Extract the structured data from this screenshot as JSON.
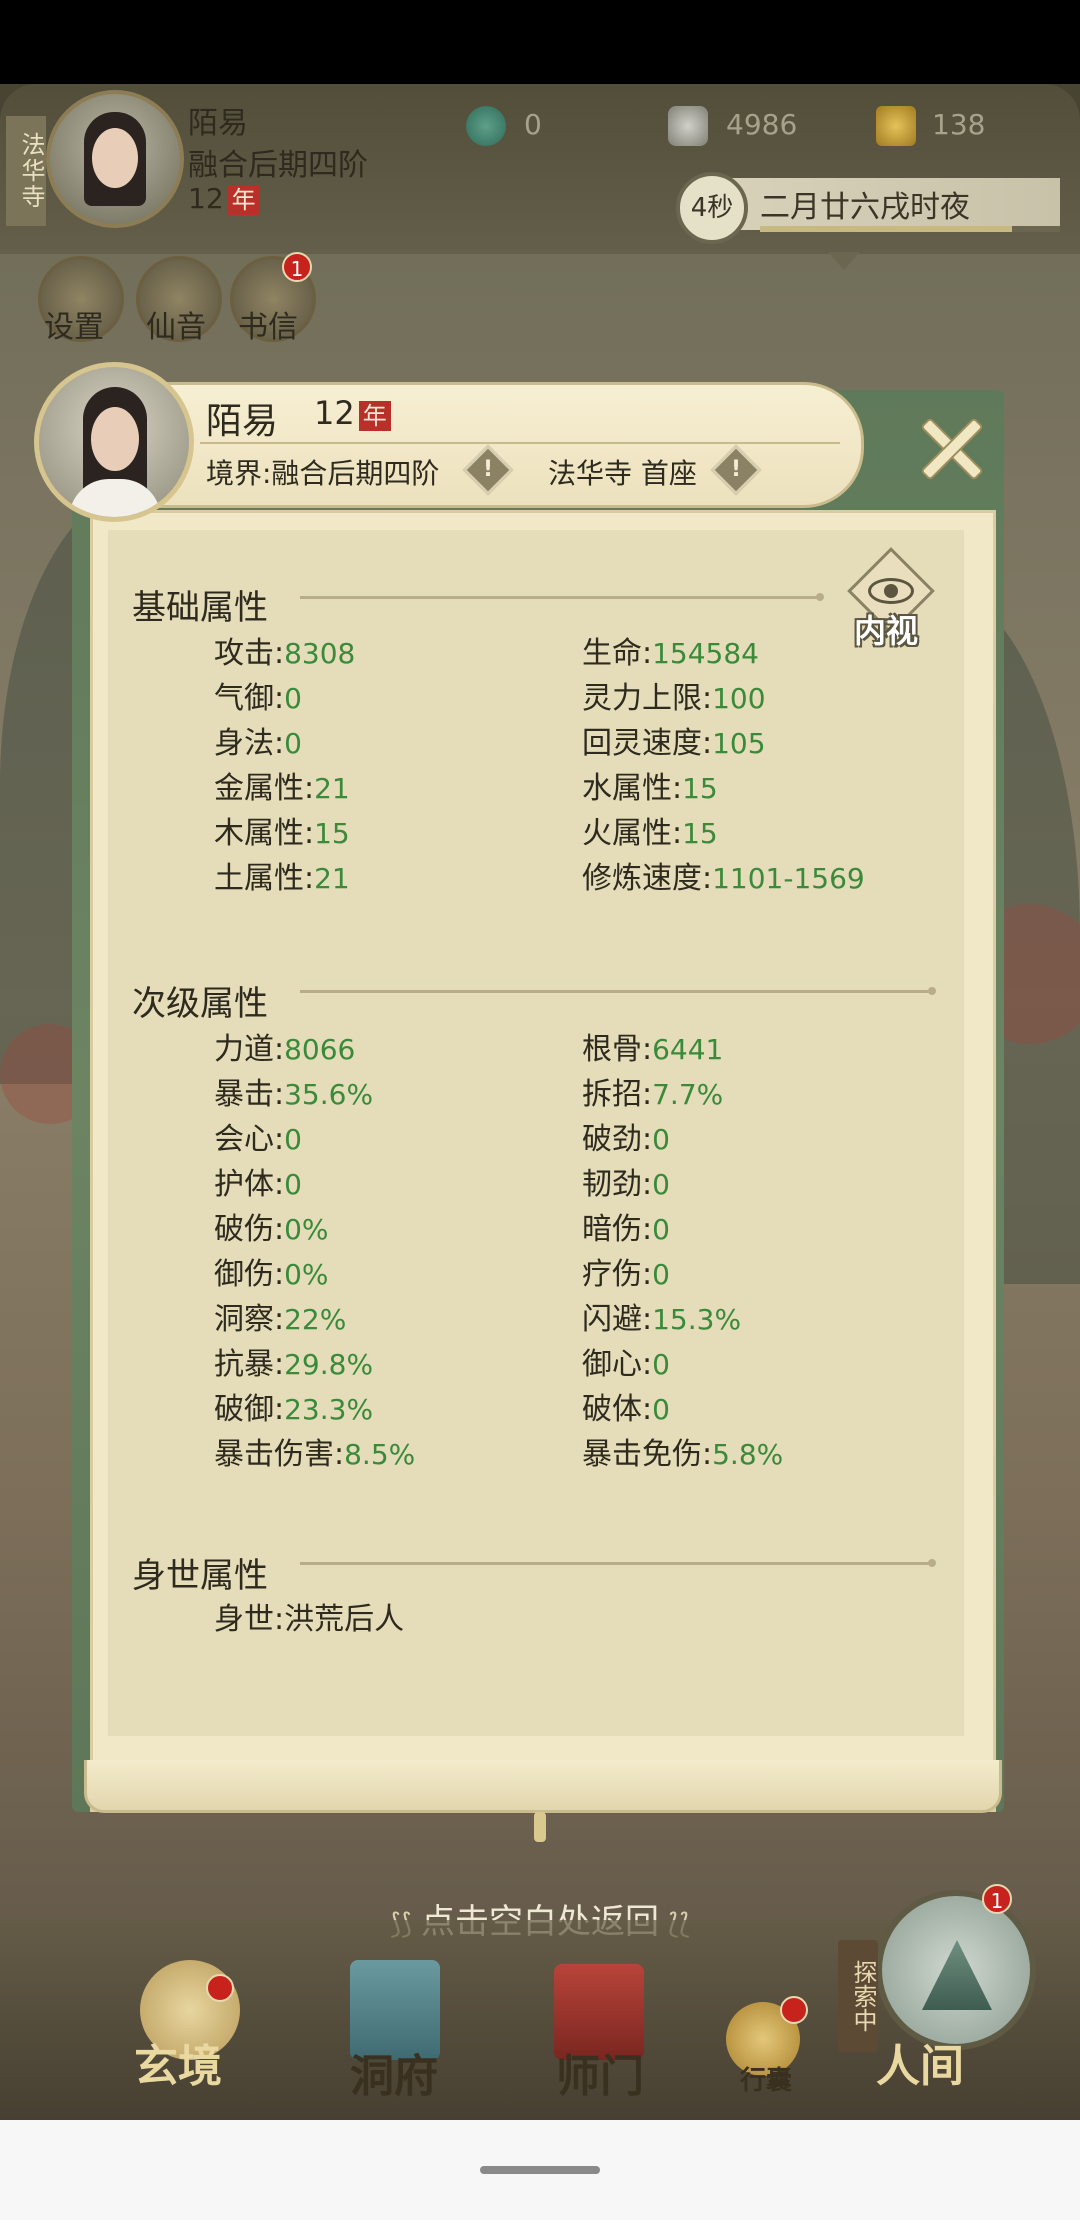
{
  "hud": {
    "sect_tag": "法华寺",
    "player_name": "陌易",
    "realm": "融合后期四阶",
    "age": "12",
    "age_unit": "年",
    "resources": [
      {
        "icon": "jade-icon",
        "value": "0"
      },
      {
        "icon": "coin-icon",
        "value": "4986"
      },
      {
        "icon": "gold-ingot-icon",
        "value": "138"
      }
    ],
    "timer": "4秒",
    "time_text": "二月廿六戌时夜",
    "menu": [
      {
        "label": "设置",
        "icon": "settings-icon"
      },
      {
        "label": "仙音",
        "icon": "music-icon"
      },
      {
        "label": "书信",
        "icon": "letter-icon",
        "badge": "1"
      }
    ]
  },
  "modal": {
    "name": "陌易",
    "age": "12",
    "age_unit": "年",
    "realm_label": "境界:融合后期四阶",
    "sect_label": "法华寺 首座",
    "inner_view_label": "内视",
    "sections": {
      "basic": {
        "title": "基础属性",
        "stats": [
          {
            "name": "攻击",
            "value": "8308"
          },
          {
            "name": "生命",
            "value": "154584"
          },
          {
            "name": "气御",
            "value": "0"
          },
          {
            "name": "灵力上限",
            "value": "100"
          },
          {
            "name": "身法",
            "value": "0"
          },
          {
            "name": "回灵速度",
            "value": "105"
          },
          {
            "name": "金属性",
            "value": "21"
          },
          {
            "name": "水属性",
            "value": "15"
          },
          {
            "name": "木属性",
            "value": "15"
          },
          {
            "name": "火属性",
            "value": "15"
          },
          {
            "name": "土属性",
            "value": "21"
          },
          {
            "name": "修炼速度",
            "value": "1101-1569"
          }
        ]
      },
      "secondary": {
        "title": "次级属性",
        "stats": [
          {
            "name": "力道",
            "value": "8066"
          },
          {
            "name": "根骨",
            "value": "6441"
          },
          {
            "name": "暴击",
            "value": "35.6%"
          },
          {
            "name": "拆招",
            "value": "7.7%"
          },
          {
            "name": "会心",
            "value": "0"
          },
          {
            "name": "破劲",
            "value": "0"
          },
          {
            "name": "护体",
            "value": "0"
          },
          {
            "name": "韧劲",
            "value": "0"
          },
          {
            "name": "破伤",
            "value": "0%"
          },
          {
            "name": "暗伤",
            "value": "0"
          },
          {
            "name": "御伤",
            "value": "0%"
          },
          {
            "name": "疗伤",
            "value": "0"
          },
          {
            "name": "洞察",
            "value": "22%"
          },
          {
            "name": "闪避",
            "value": "15.3%"
          },
          {
            "name": "抗暴",
            "value": "29.8%"
          },
          {
            "name": "御心",
            "value": "0"
          },
          {
            "name": "破御",
            "value": "23.3%"
          },
          {
            "name": "破体",
            "value": "0"
          },
          {
            "name": "暴击伤害",
            "value": "8.5%"
          },
          {
            "name": "暴击免伤",
            "value": "5.8%"
          }
        ]
      },
      "background": {
        "title": "身世属性",
        "stats": [
          {
            "name": "身世",
            "value": "洪荒后人"
          }
        ]
      }
    }
  },
  "tap_return": "点击空白处返回",
  "bottom_nav": [
    {
      "label": "玄境",
      "badge": ""
    },
    {
      "label": "洞府",
      "badge": ""
    },
    {
      "label": "师门",
      "badge": ""
    },
    {
      "label": "行囊",
      "badge": ""
    },
    {
      "label": "人间",
      "badge": "1"
    }
  ],
  "explore_tag": "探索中",
  "colors": {
    "value_green": "#3a8a3a",
    "panel_green": "#6c8462",
    "parchment": "#e5dcba",
    "badge_red": "#c8221c"
  }
}
